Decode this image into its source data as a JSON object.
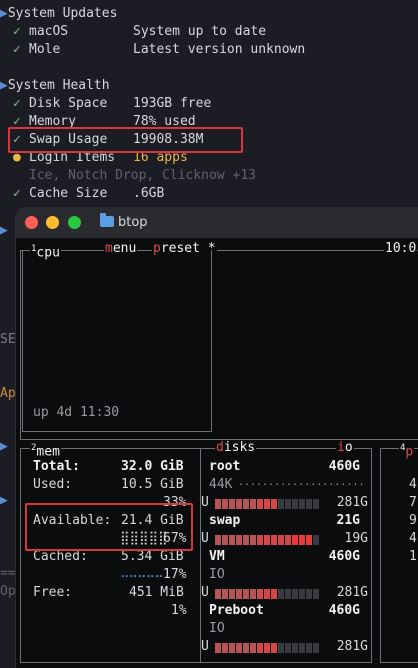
{
  "terminal": {
    "system_updates": {
      "header": "System Updates",
      "items": [
        {
          "mark": "✓",
          "label": "macOS",
          "value": "System up to date"
        },
        {
          "mark": "✓",
          "label": "Mole",
          "value": "Latest version unknown"
        }
      ]
    },
    "system_health": {
      "header": "System Health",
      "items": [
        {
          "mark": "✓",
          "label": "Disk Space",
          "value": "193GB free"
        },
        {
          "mark": "✓",
          "label": "Memory",
          "value": "78% used"
        },
        {
          "mark": "✓",
          "label": "Swap Usage",
          "value": "19908.38M"
        },
        {
          "mark": "●",
          "label": "Login Items",
          "value": "16 apps"
        },
        {
          "mark": "",
          "label": "",
          "value": "Ice, Notch Drop, Clicknow +13"
        },
        {
          "mark": "✓",
          "label": "Cache Size",
          "value": ".6GB"
        }
      ]
    },
    "left_fragments": [
      "SE",
      "Ap",
      "==",
      "Op"
    ]
  },
  "window": {
    "title": "btop",
    "traffic_lights": {
      "close": "#ff5f57",
      "minimize": "#febc2e",
      "zoom": "#28c840"
    }
  },
  "btop": {
    "cpu_panel": {
      "tab_num": "1",
      "tab_cpu": "cpu",
      "menu_hotkey": "m",
      "menu_rest": "enu",
      "preset_hotkey": "p",
      "preset_rest": "reset *",
      "clock": "10:0",
      "uptime": "up 4d 11:30"
    },
    "mem_panel": {
      "tab_num": "2",
      "tab_label": "mem",
      "total_label": "Total:",
      "total_value": "32.0 GiB",
      "used_label": "Used:",
      "used_value": "10.5 GiB",
      "used_pct": "33%",
      "used_fraction": 0.33,
      "available_label": "Available:",
      "available_value": "21.4 GiB",
      "available_pct": "67%",
      "available_fraction": 0.67,
      "cached_label": "Cached:",
      "cached_value": "5.34 GiB",
      "cached_pct": "17%",
      "cached_fraction": 0.17,
      "free_label": "Free:",
      "free_value": "451 MiB",
      "free_pct": "1%",
      "free_fraction": 0.01
    },
    "disks_panel": {
      "tab_hotkey": "d",
      "tab_rest": "isks",
      "io_hotkey": "i",
      "io_rest": "o",
      "disks": [
        {
          "name": "root",
          "size": "460G",
          "sub": "44K",
          "used": "281G",
          "used_fraction": 0.61
        },
        {
          "name": "swap",
          "size": "21G",
          "sub": "",
          "used": "19G",
          "used_fraction": 0.9
        },
        {
          "name": "VM",
          "size": "460G",
          "sub": "IO",
          "used": "281G",
          "used_fraction": 0.61
        },
        {
          "name": "Preboot",
          "size": "460G",
          "sub": "IO",
          "used": "281G",
          "used_fraction": 0.61
        }
      ],
      "u_label": "U"
    },
    "proc_panel": {
      "tab_num": "4",
      "tab_hotkey": "p",
      "values": [
        "4",
        "7",
        "9",
        "4",
        "1"
      ]
    }
  }
}
